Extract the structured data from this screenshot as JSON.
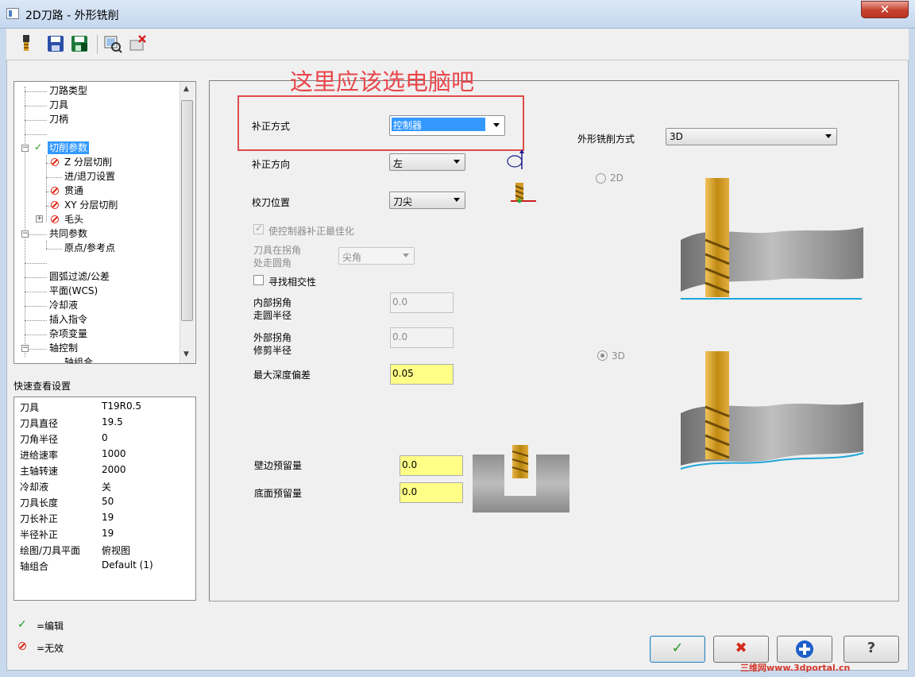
{
  "window": {
    "title": "2D刀路 - 外形铣削"
  },
  "annotation": {
    "text": "这里应该选电脑吧"
  },
  "tree": {
    "items": [
      {
        "label": "刀路类型"
      },
      {
        "label": "刀具"
      },
      {
        "label": "刀柄"
      },
      {
        "label": ""
      },
      {
        "label": "切削参数",
        "status": "edited"
      },
      {
        "label": "Z 分层切削",
        "status": "disabled"
      },
      {
        "label": "进/退刀设置"
      },
      {
        "label": "贯通",
        "status": "disabled"
      },
      {
        "label": "XY 分层切削",
        "status": "disabled"
      },
      {
        "label": "毛头",
        "status": "disabled"
      },
      {
        "label": "共同参数"
      },
      {
        "label": "原点/参考点"
      },
      {
        "label": ""
      },
      {
        "label": "圆弧过滤/公差"
      },
      {
        "label": "平面(WCS)"
      },
      {
        "label": "冷却液"
      },
      {
        "label": "插入指令"
      },
      {
        "label": "杂项变量"
      },
      {
        "label": "轴控制"
      },
      {
        "label": "轴组合"
      }
    ]
  },
  "quick": {
    "title": "快速查看设置",
    "rows": [
      {
        "label": "刀具",
        "value": "T19R0.5"
      },
      {
        "label": "刀具直径",
        "value": "19.5"
      },
      {
        "label": "刀角半径",
        "value": "0"
      },
      {
        "label": "进给速率",
        "value": "1000"
      },
      {
        "label": "主轴转速",
        "value": "2000"
      },
      {
        "label": "冷却液",
        "value": "关"
      },
      {
        "label": "刀具长度",
        "value": "50"
      },
      {
        "label": "刀长补正",
        "value": "19"
      },
      {
        "label": "半径补正",
        "value": "19"
      },
      {
        "label": "绘图/刀具平面",
        "value": "俯视图"
      },
      {
        "label": "轴组合",
        "value": "Default (1)"
      }
    ]
  },
  "legend": {
    "edited": "=编辑",
    "disabled": "=无效"
  },
  "params": {
    "comp_type_label": "补正方式",
    "comp_type_value": "控制器",
    "comp_dir_label": "补正方向",
    "comp_dir_value": "左",
    "tip_comp_label": "校刀位置",
    "tip_comp_value": "刀尖",
    "optimize_label": "使控制器补正最佳化",
    "roll_label_1": "刀具在拐角",
    "roll_label_2": "处走圆角",
    "roll_value": "尖角",
    "infinite_look_label": "寻找相交性",
    "inner_label_1": "内部拐角",
    "inner_label_2": "走圆半径",
    "inner_value": "0.0",
    "outer_label_1": "外部拐角",
    "outer_label_2": "修剪半径",
    "outer_value": "0.0",
    "max_depth_label": "最大深度偏差",
    "max_depth_value": "0.05",
    "wall_stock_label": "壁边预留量",
    "wall_stock_value": "0.0",
    "floor_stock_label": "底面预留量",
    "floor_stock_value": "0.0",
    "contour_type_label": "外形铣削方式",
    "contour_type_value": "3D",
    "radio_2d": "2D",
    "radio_3d": "3D"
  },
  "watermark": "三维网www.3dportal.cn"
}
